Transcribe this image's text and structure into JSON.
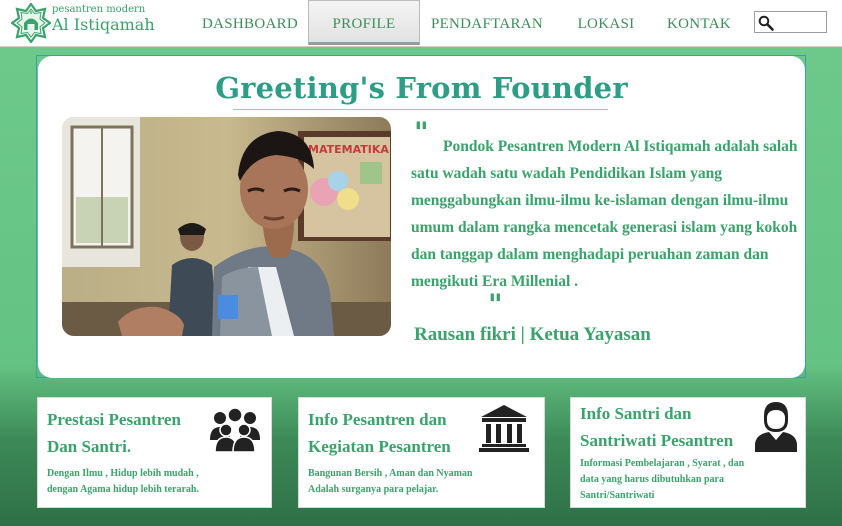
{
  "brand": {
    "subtitle": "pesantren modern",
    "name": "Al Istiqamah"
  },
  "nav": {
    "items": [
      "DASHBOARD",
      "PROFILE",
      "PENDAFTARAN",
      "LOKASI",
      "KONTAK"
    ],
    "active": "PROFILE"
  },
  "search": {
    "icon": "magnifier-icon"
  },
  "greeting": {
    "title": "Greeting's From Founder",
    "quote": "Pondok Pesantren Modern Al Istiqamah adalah salah satu wadah satu wadah Pendidikan Islam yang menggabungkan ilmu-ilmu ke-islaman dengan ilmu-ilmu umum dalam rangka mencetak generasi islam yang kokoh dan tanggap dalam menghadapi peruahan zaman dan mengikuti Era Millenial .",
    "open_quote": "\"",
    "close_quote": "\"",
    "founder": "Rausan fikri | Ketua Yayasan"
  },
  "cards": [
    {
      "title_line1": "Prestasi Pesantren",
      "title_line2": "Dan Santri.",
      "desc_line1": "Dengan Ilmu , Hidup lebih mudah ,",
      "desc_line2": "dengan Agama hidup lebih terarah.",
      "icon": "group-icon"
    },
    {
      "title_line1": "Info Pesantren  dan",
      "title_line2": "Kegiatan Pesantren",
      "desc_line1": "Bangunan Bersih , Aman dan Nyaman",
      "desc_line2": "Adalah surganya para pelajar.",
      "icon": "institution-icon"
    },
    {
      "title_line1": "Info Santri dan",
      "title_line2": "Santriwati Pesantren",
      "desc_line1": "Informasi Pembelajaran , Syarat , dan",
      "desc_line2": "data yang harus dibutuhkan para",
      "desc_line3": "Santri/Santriwati",
      "icon": "person-icon"
    }
  ],
  "colors": {
    "accent": "#3aa36b",
    "title": "#2d9e85",
    "background_top": "#6cc98a",
    "background_bottom": "#2e7046"
  }
}
